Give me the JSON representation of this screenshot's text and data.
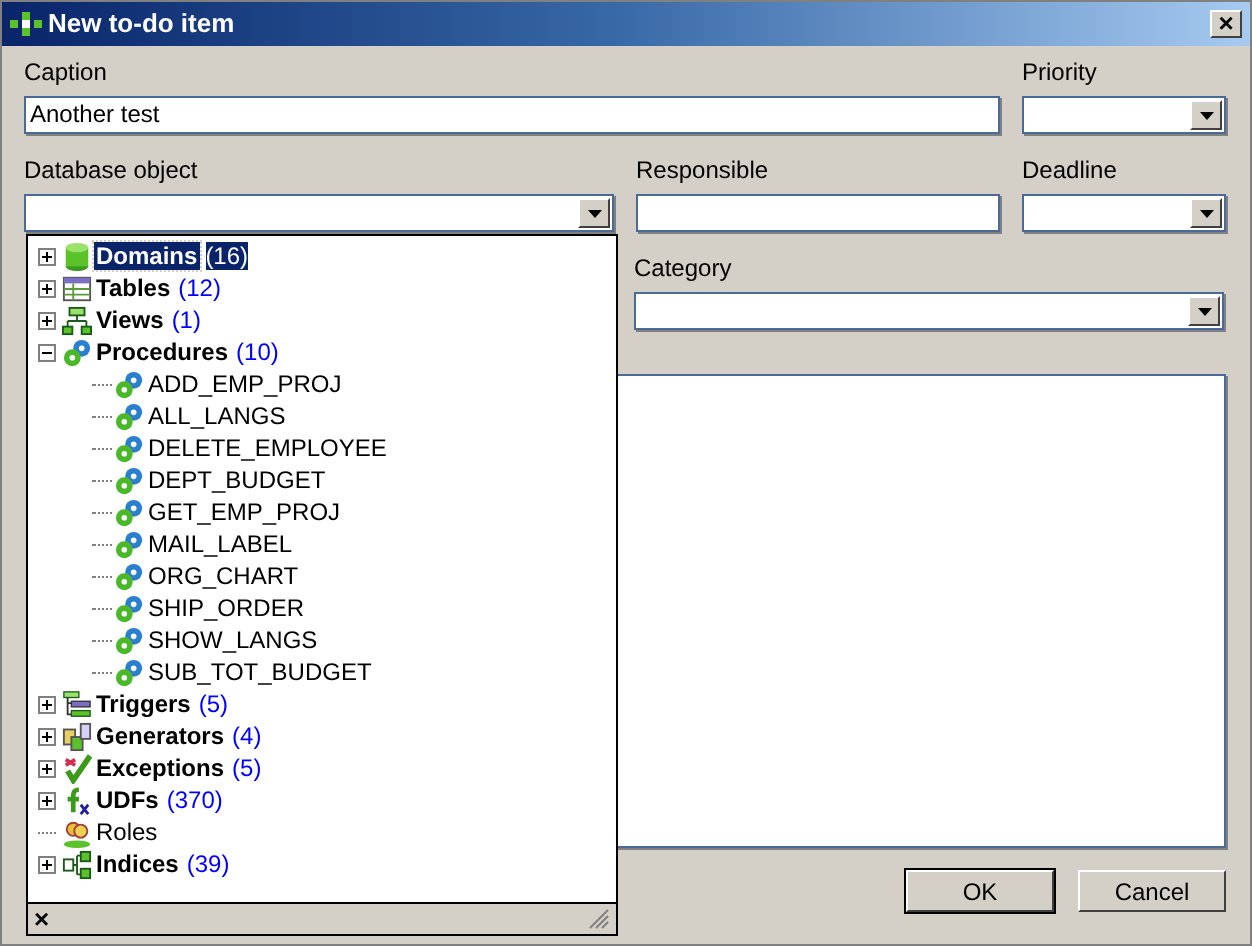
{
  "window": {
    "title": "New to-do item",
    "close": "×"
  },
  "form": {
    "caption": {
      "label": "Caption",
      "value": "Another test"
    },
    "priority": {
      "label": "Priority"
    },
    "database_object": {
      "label": "Database object"
    },
    "responsible": {
      "label": "Responsible"
    },
    "deadline": {
      "label": "Deadline"
    },
    "category": {
      "label": "Category"
    }
  },
  "tree": [
    {
      "kind": "domain",
      "label": "Domains",
      "count": "(16)",
      "selected": true,
      "expanded": false
    },
    {
      "kind": "table",
      "label": "Tables",
      "count": "(12)",
      "selected": false,
      "expanded": false
    },
    {
      "kind": "view",
      "label": "Views",
      "count": "(1)",
      "selected": false,
      "expanded": false
    },
    {
      "kind": "procedure",
      "label": "Procedures",
      "count": "(10)",
      "selected": false,
      "expanded": true,
      "children": [
        {
          "kind": "procedure",
          "label": "ADD_EMP_PROJ",
          "selected": false
        },
        {
          "kind": "procedure",
          "label": "ALL_LANGS",
          "selected": false
        },
        {
          "kind": "procedure",
          "label": "DELETE_EMPLOYEE",
          "selected": false
        },
        {
          "kind": "procedure",
          "label": "DEPT_BUDGET",
          "selected": false
        },
        {
          "kind": "procedure",
          "label": "GET_EMP_PROJ",
          "selected": false
        },
        {
          "kind": "procedure",
          "label": "MAIL_LABEL",
          "selected": false
        },
        {
          "kind": "procedure",
          "label": "ORG_CHART",
          "selected": false
        },
        {
          "kind": "procedure",
          "label": "SHIP_ORDER",
          "selected": false
        },
        {
          "kind": "procedure",
          "label": "SHOW_LANGS",
          "selected": false
        },
        {
          "kind": "procedure",
          "label": "SUB_TOT_BUDGET",
          "selected": false
        }
      ]
    },
    {
      "kind": "trigger",
      "label": "Triggers",
      "count": "(5)",
      "selected": false,
      "expanded": false
    },
    {
      "kind": "generator",
      "label": "Generators",
      "count": "(4)",
      "selected": false,
      "expanded": false
    },
    {
      "kind": "exception",
      "label": "Exceptions",
      "count": "(5)",
      "selected": false,
      "expanded": false
    },
    {
      "kind": "udf",
      "label": "UDFs",
      "count": "(370)",
      "selected": false,
      "expanded": false
    },
    {
      "kind": "role",
      "label": "Roles",
      "selected": false
    },
    {
      "kind": "index",
      "label": "Indices",
      "count": "(39)",
      "selected": false,
      "expanded": false
    }
  ],
  "popup_footer": {
    "close": "×"
  },
  "buttons": [
    {
      "label": "OK",
      "default": true
    },
    {
      "label": "Cancel",
      "default": false
    }
  ]
}
